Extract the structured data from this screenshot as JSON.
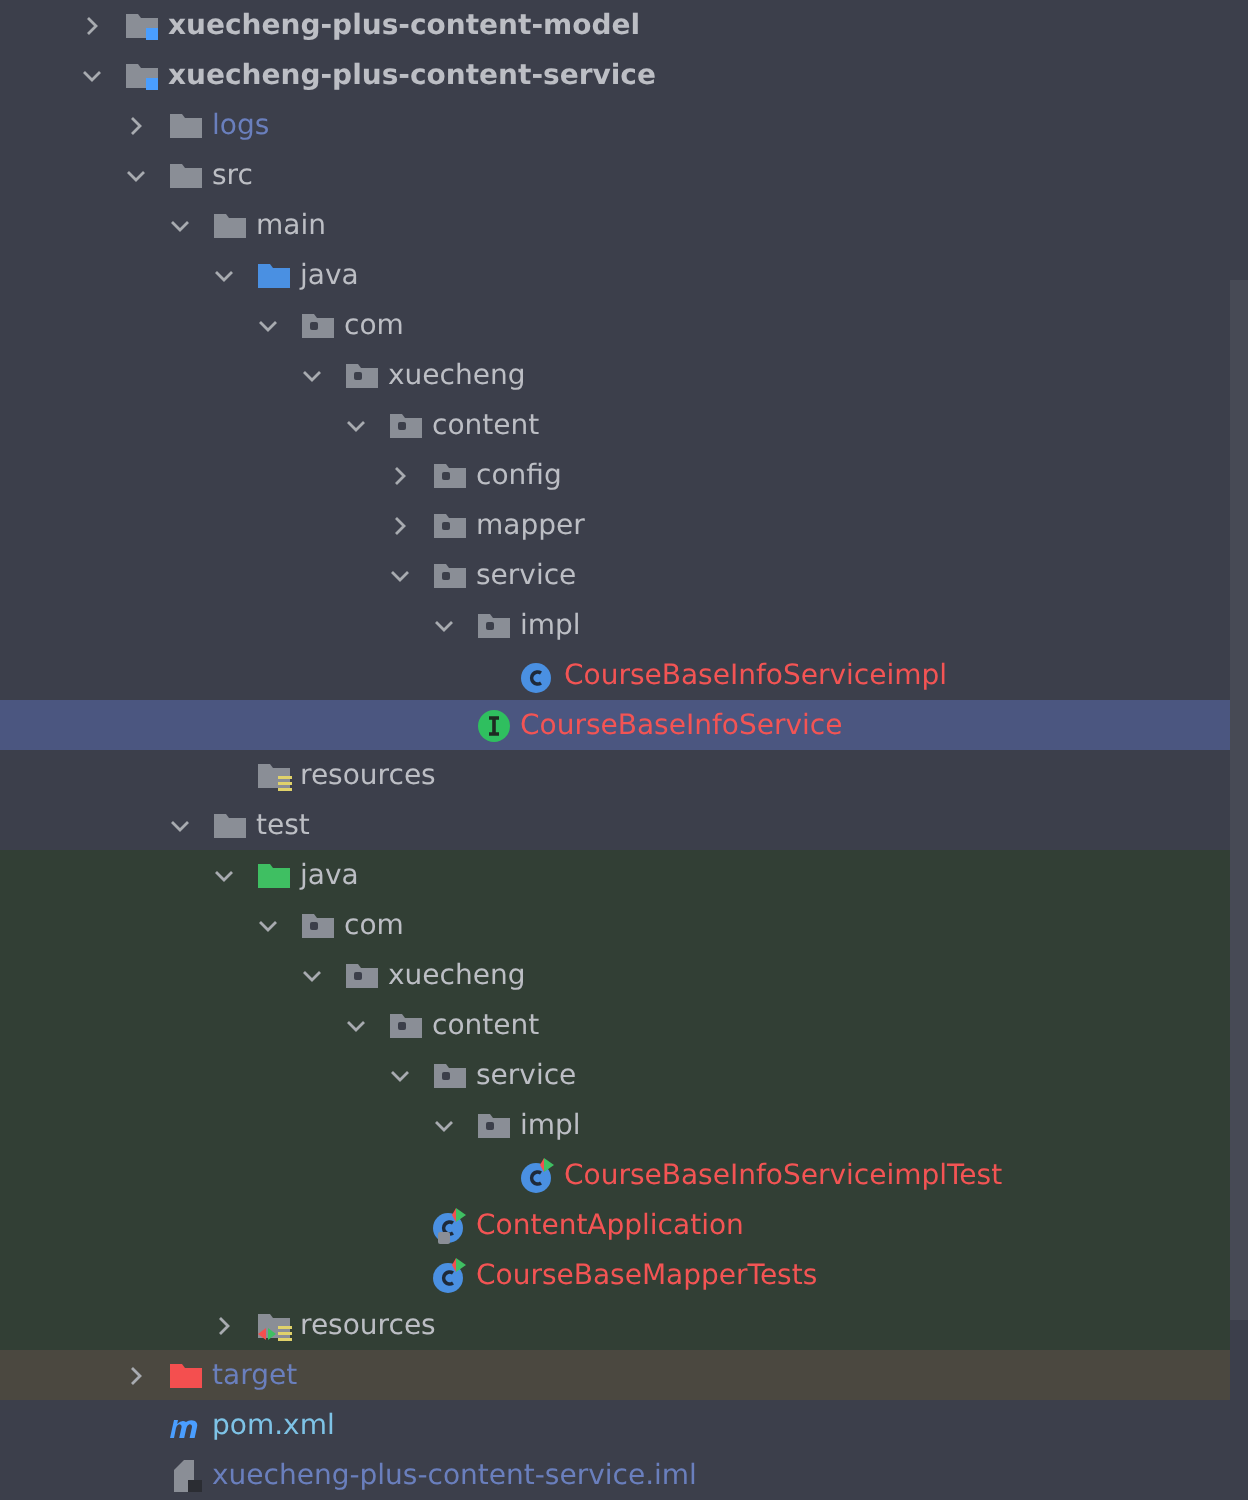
{
  "tree": [
    {
      "name": "xuecheng-plus-content-model",
      "kind": "module",
      "color": "#bcbec4",
      "expanded": false,
      "selected": false
    },
    {
      "name": "xuecheng-plus-content-service",
      "kind": "module",
      "color": "#bcbec4",
      "expanded": true,
      "selected": false,
      "children": [
        {
          "name": "logs",
          "kind": "folder",
          "color": "#6a7fbd",
          "expanded": false,
          "selected": false
        },
        {
          "name": "src",
          "kind": "folder",
          "color": "#bcbec4",
          "expanded": true,
          "selected": false,
          "children": [
            {
              "name": "main",
              "kind": "folder",
              "color": "#bcbec4",
              "expanded": true,
              "selected": false,
              "children": [
                {
                  "name": "java",
                  "kind": "source-root",
                  "color": "#bcbec4",
                  "expanded": true,
                  "selected": false,
                  "children": [
                    {
                      "name": "com",
                      "kind": "package",
                      "color": "#bcbec4",
                      "expanded": true,
                      "selected": false,
                      "children": [
                        {
                          "name": "xuecheng",
                          "kind": "package",
                          "color": "#bcbec4",
                          "expanded": true,
                          "selected": false,
                          "children": [
                            {
                              "name": "content",
                              "kind": "package",
                              "color": "#bcbec4",
                              "expanded": true,
                              "selected": false,
                              "children": [
                                {
                                  "name": "config",
                                  "kind": "package",
                                  "color": "#bcbec4",
                                  "expanded": false,
                                  "selected": false
                                },
                                {
                                  "name": "mapper",
                                  "kind": "package",
                                  "color": "#bcbec4",
                                  "expanded": false,
                                  "selected": false
                                },
                                {
                                  "name": "service",
                                  "kind": "package",
                                  "color": "#bcbec4",
                                  "expanded": true,
                                  "selected": false,
                                  "children": [
                                    {
                                      "name": "impl",
                                      "kind": "package",
                                      "color": "#bcbec4",
                                      "expanded": true,
                                      "selected": false,
                                      "children": [
                                        {
                                          "name": "CourseBaseInfoServiceimpl",
                                          "kind": "class",
                                          "color": "#f35454",
                                          "selected": false
                                        }
                                      ]
                                    },
                                    {
                                      "name": "CourseBaseInfoService",
                                      "kind": "interface",
                                      "color": "#f35454",
                                      "selected": true
                                    }
                                  ]
                                }
                              ]
                            }
                          ]
                        }
                      ]
                    }
                  ]
                },
                {
                  "name": "resources",
                  "kind": "resources-root",
                  "color": "#bcbec4",
                  "selected": false
                }
              ]
            },
            {
              "name": "test",
              "kind": "test-folder",
              "color": "#bcbec4",
              "expanded": true,
              "selected": false,
              "children": [
                {
                  "name": "java",
                  "kind": "test-root",
                  "color": "#bcbec4",
                  "expanded": true,
                  "selected": false,
                  "children": [
                    {
                      "name": "com",
                      "kind": "package",
                      "color": "#bcbec4",
                      "expanded": true,
                      "selected": false,
                      "children": [
                        {
                          "name": "xuecheng",
                          "kind": "package",
                          "color": "#bcbec4",
                          "expanded": true,
                          "selected": false,
                          "children": [
                            {
                              "name": "content",
                              "kind": "package",
                              "color": "#bcbec4",
                              "expanded": true,
                              "selected": false,
                              "children": [
                                {
                                  "name": "service",
                                  "kind": "package",
                                  "color": "#bcbec4",
                                  "expanded": true,
                                  "selected": false,
                                  "children": [
                                    {
                                      "name": "impl",
                                      "kind": "package",
                                      "color": "#bcbec4",
                                      "expanded": true,
                                      "selected": false,
                                      "children": [
                                        {
                                          "name": "CourseBaseInfoServiceimplTest",
                                          "kind": "test-class",
                                          "color": "#f35454",
                                          "selected": false
                                        }
                                      ]
                                    }
                                  ]
                                },
                                {
                                  "name": "ContentApplication",
                                  "kind": "app-class",
                                  "color": "#f35454",
                                  "selected": false
                                },
                                {
                                  "name": "CourseBaseMapperTests",
                                  "kind": "test-class",
                                  "color": "#f35454",
                                  "selected": false
                                }
                              ]
                            }
                          ]
                        }
                      ]
                    }
                  ]
                },
                {
                  "name": "resources",
                  "kind": "test-resources-root",
                  "color": "#bcbec4",
                  "expanded": false,
                  "selected": false
                }
              ]
            }
          ]
        },
        {
          "name": "target",
          "kind": "excluded",
          "color": "#6a7fbd",
          "expanded": false,
          "selected": false
        },
        {
          "name": "pom.xml",
          "kind": "maven",
          "color": "#7ec3e6",
          "selected": false
        },
        {
          "name": "xuecheng-plus-content-service.iml",
          "kind": "iml",
          "color": "#6a7fbd",
          "selected": false
        }
      ]
    }
  ]
}
